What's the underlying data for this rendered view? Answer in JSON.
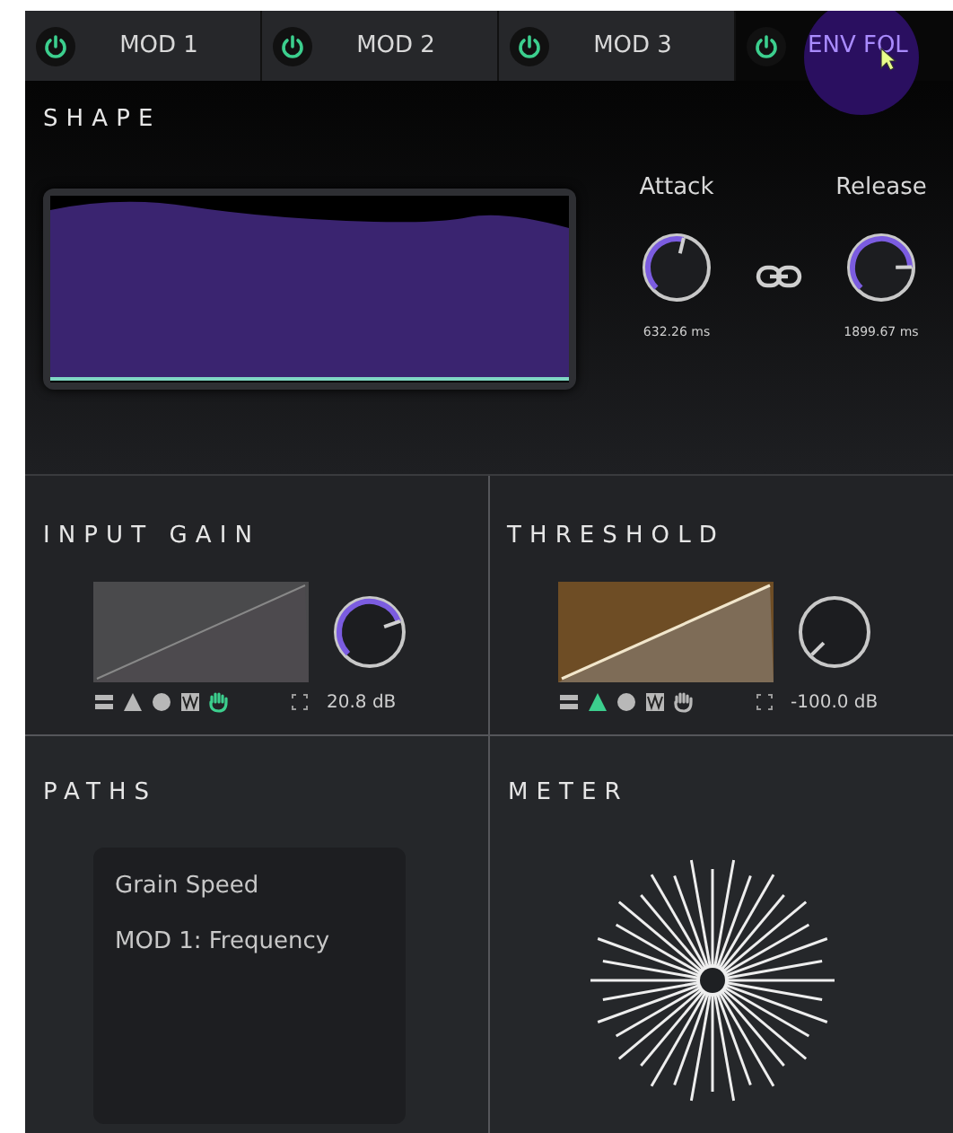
{
  "tabs": [
    {
      "label": "MOD 1",
      "on": true,
      "selected": false
    },
    {
      "label": "MOD 2",
      "on": true,
      "selected": false
    },
    {
      "label": "MOD 3",
      "on": true,
      "selected": false
    },
    {
      "label": "ENV FOL",
      "on": true,
      "selected": true
    }
  ],
  "shape": {
    "title": "SHAPE",
    "linked": true,
    "knobs": [
      {
        "label": "Attack",
        "reading": "632.26 ms"
      },
      {
        "label": "Release",
        "reading": "1899.67 ms"
      }
    ]
  },
  "sections": [
    {
      "title": "INPUT GAIN",
      "active": false,
      "reading": "20.8 dB",
      "modes": [
        {
          "kind": "bars",
          "selected": false
        },
        {
          "kind": "triangle",
          "selected": false
        },
        {
          "kind": "circle",
          "selected": false
        },
        {
          "kind": "wave",
          "selected": false
        },
        {
          "kind": "hand",
          "selected": true
        }
      ]
    },
    {
      "title": "THRESHOLD",
      "active": true,
      "reading": "-100.0 dB",
      "modes": [
        {
          "kind": "bars",
          "selected": false
        },
        {
          "kind": "triangle",
          "selected": true
        },
        {
          "kind": "circle",
          "selected": false
        },
        {
          "kind": "wave",
          "selected": false
        },
        {
          "kind": "hand",
          "selected": false
        }
      ]
    }
  ],
  "paths": {
    "title": "PATHS",
    "items": [
      "Grain Speed",
      "MOD 1: Frequency"
    ]
  },
  "meter": {
    "title": "METER"
  }
}
